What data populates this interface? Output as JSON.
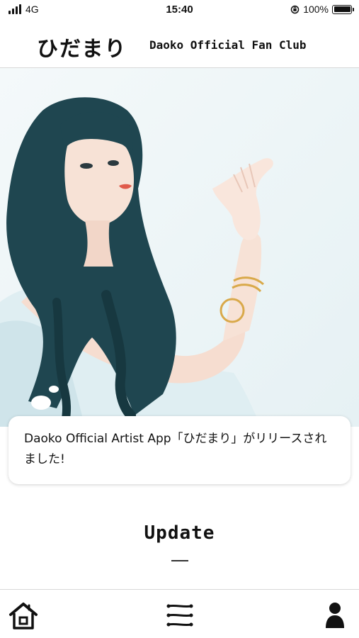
{
  "status_bar": {
    "carrier": "4G",
    "time": "15:40",
    "battery": "100%",
    "battery_level": 1.0
  },
  "header": {
    "logo": "ひだまり",
    "subtitle": "Daoko Official Fan Club"
  },
  "news": {
    "text": "Daoko Official Artist App「ひだまり」がリリースされました!"
  },
  "update_section": {
    "title": "Update"
  },
  "tabbar": {
    "items": [
      {
        "icon": "home-icon"
      },
      {
        "icon": "menu-icon"
      },
      {
        "icon": "person-icon"
      }
    ]
  },
  "colors": {
    "hair": "#1f4650",
    "skin": "#f7e2d6",
    "background": "#ffffff",
    "hero_bg": "#eef6f8"
  }
}
